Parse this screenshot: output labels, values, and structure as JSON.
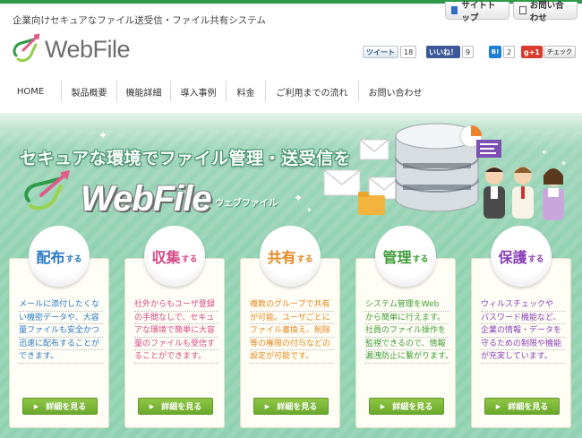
{
  "header": {
    "tagline": "企業向けセキュアなファイル送受信・ファイル共有システム",
    "top_buttons": [
      {
        "label": "サイトトップ",
        "icon": "sitemap-icon"
      },
      {
        "label": "お問い合わせ",
        "icon": "mail-icon"
      }
    ],
    "logo_text": "WebFile"
  },
  "social": {
    "tweet_label": "ツイート",
    "tweet_count": "18",
    "like_label": "いいね！",
    "like_count": "9",
    "hatena_label": "B!",
    "hatena_count": "2",
    "gplus_label": "g+1",
    "check_label": "チェック"
  },
  "nav": {
    "items": [
      {
        "label": "HOME"
      },
      {
        "label": "製品概要"
      },
      {
        "label": "機能詳細"
      },
      {
        "label": "導入事例"
      },
      {
        "label": "料金"
      },
      {
        "label": "ご利用までの流れ"
      },
      {
        "label": "お問い合わせ"
      }
    ]
  },
  "hero": {
    "headline": "セキュアな環境でファイル管理・送受信を",
    "logo_text": "WebFile",
    "logo_reading": "ウェブファイル"
  },
  "features": [
    {
      "title": "配布",
      "suffix": "する",
      "color": "#2a78c8",
      "lines": [
        "メールに添付したくな",
        "い機密データや、大容",
        "量ファイルも安全かつ",
        "迅速に配布することが",
        "できます。"
      ],
      "button": "詳細を見る"
    },
    {
      "title": "収集",
      "suffix": "する",
      "color": "#d44a86",
      "lines": [
        "社外からもユーザ登録",
        "の手間なしで、セキュ",
        "アな環境で簡単に大容",
        "量のファイルも受信す",
        "ることができます。"
      ],
      "button": "詳細を見る"
    },
    {
      "title": "共有",
      "suffix": "する",
      "color": "#e7861c",
      "lines": [
        "複数のグループで共有",
        "が可能。ユーザごとに",
        "ファイル書換え、削除",
        "等の権限の付与などの",
        "設定が可能です。"
      ],
      "button": "詳細を見る"
    },
    {
      "title": "管理",
      "suffix": "する",
      "color": "#3f9b38",
      "lines": [
        "システム管理をWeb",
        "から簡単に行えます。",
        "社員のファイル操作を",
        "監視できるので、情報",
        "漏洩防止に繋がります。"
      ],
      "button": "詳細を見る"
    },
    {
      "title": "保護",
      "suffix": "する",
      "color": "#8a3fb8",
      "lines": [
        "ウィルスチェックや",
        "パスワード機能など、",
        "企業の情報・データを",
        "守るための制限や機能",
        "が充実しています。"
      ],
      "button": "詳細を見る"
    }
  ]
}
